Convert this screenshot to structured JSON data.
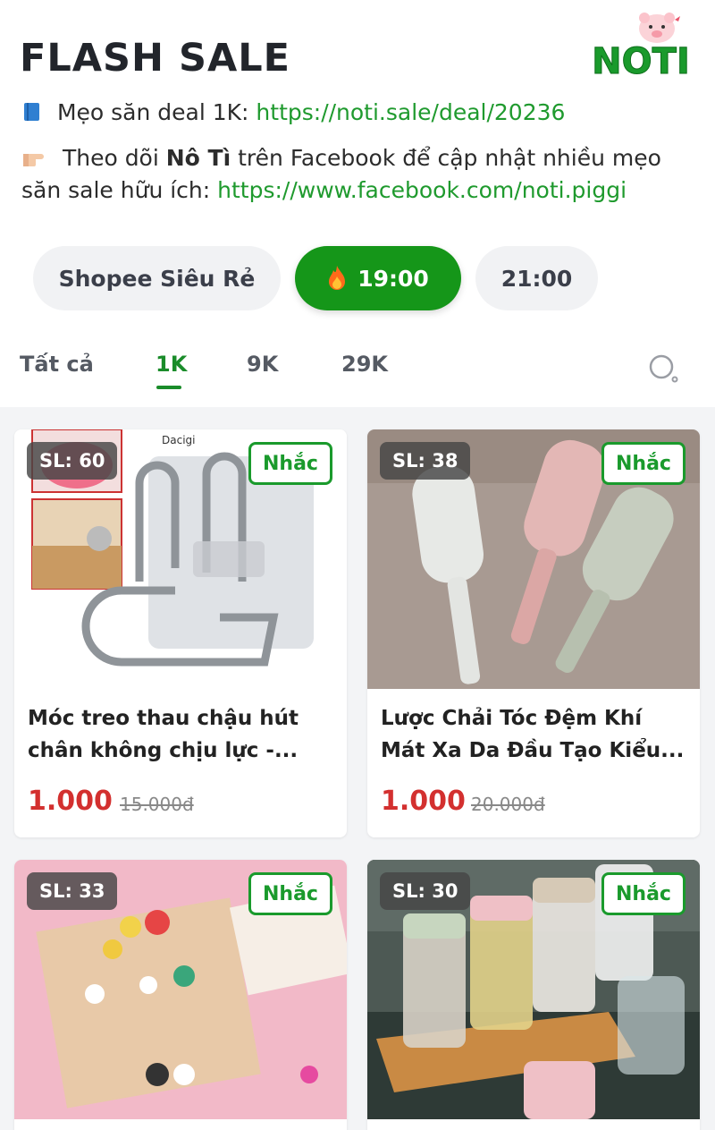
{
  "header": {
    "title": "FLASH SALE",
    "logo_text": "NOTI",
    "tip_icon": "blue-book-icon",
    "tip_label": "Mẹo săn deal 1K: ",
    "tip_link": "https://noti.sale/deal/20236",
    "follow_icon": "pointing-hand-icon",
    "follow_prefix": "Theo dõi ",
    "follow_brand": "Nô Tì",
    "follow_suffix": " trên Facebook để cập nhật nhiều mẹo săn sale hữu ích: ",
    "follow_link": "https://www.facebook.com/noti.piggi"
  },
  "sessions": [
    {
      "label": "Shopee Siêu Rẻ",
      "active": false
    },
    {
      "label": "19:00",
      "active": true,
      "icon": "fire-icon"
    },
    {
      "label": "21:00",
      "active": false
    }
  ],
  "filter_tabs": [
    {
      "label": "Tất cả",
      "active": false
    },
    {
      "label": "1K",
      "active": true
    },
    {
      "label": "9K",
      "active": false
    },
    {
      "label": "29K",
      "active": false
    }
  ],
  "products": [
    {
      "badge": "SL: 60",
      "remind": "Nhắc",
      "name": "Móc treo thau chậu hút chân không chịu lực -...",
      "price": "1.000",
      "old_price": "15.000đ",
      "image": "hook-image"
    },
    {
      "badge": "SL: 38",
      "remind": "Nhắc",
      "name": "Lược Chải Tóc Đệm Khí Mát Xa Da Đầu Tạo Kiểu...",
      "price": "1.000",
      "old_price": "20.000đ",
      "image": "brush-image"
    },
    {
      "badge": "SL: 33",
      "remind": "Nhắc",
      "image": "clips-image"
    },
    {
      "badge": "SL: 30",
      "remind": "Nhắc",
      "image": "jars-image"
    }
  ],
  "colors": {
    "accent_green": "#159619",
    "price_red": "#d3302f",
    "link_green": "#1f9a2e"
  }
}
